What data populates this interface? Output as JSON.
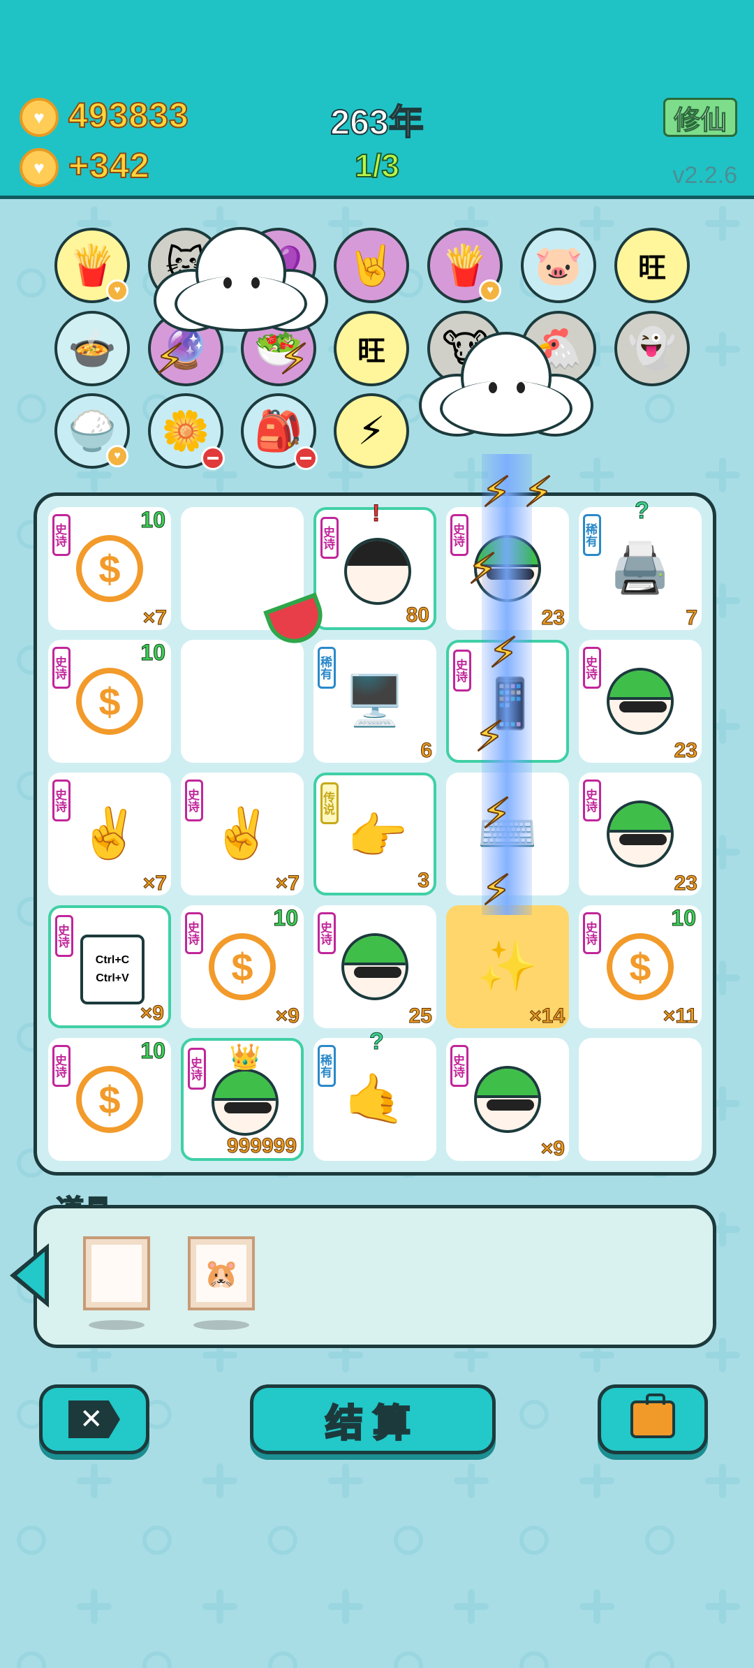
{
  "header": {
    "coins": "493833",
    "income": "+342",
    "year": "263年",
    "round": "1/3",
    "xiuxian_label": "修仙",
    "version": "v2.2.6"
  },
  "symbols": [
    {
      "icon": "🍟",
      "color": "#fff59a"
    },
    {
      "icon": "🐱",
      "color": "#d0d0c8"
    },
    {
      "icon": "💜",
      "color": "#d79ad8"
    },
    {
      "icon": "🤘",
      "color": "#d79ad8"
    },
    {
      "icon": "🍟",
      "color": "#d79ad8"
    },
    {
      "icon": "🐷",
      "color": "#c8ecf4"
    },
    {
      "icon": "旺",
      "color": "#fff59a"
    },
    {
      "icon": "🍲",
      "color": "#d0f0f4"
    },
    {
      "icon": "🔮",
      "color": "#d79ad8"
    },
    {
      "icon": "🥗",
      "color": "#d79ad8"
    },
    {
      "icon": "旺",
      "color": "#fff59a"
    },
    {
      "icon": "🐮",
      "color": "#d0d0c8"
    },
    {
      "icon": "🐔",
      "color": "#d0d0c8"
    },
    {
      "icon": "👻",
      "color": "#d0d0c8"
    },
    {
      "icon": "🍚",
      "color": "#c8ecf4"
    },
    {
      "icon": "🌼",
      "color": "#c8ecf4"
    },
    {
      "icon": "🎒",
      "color": "#c8ecf4"
    },
    {
      "icon": "⚡",
      "color": "#fff59a"
    }
  ],
  "tags": {
    "epic": "史诗",
    "rare": "稀有",
    "legend": "传说"
  },
  "cells": [
    {
      "tag": "epic",
      "icon": "coin",
      "top": "10",
      "value": "×7"
    },
    {
      "tag": "",
      "icon": "",
      "top": "",
      "value": ""
    },
    {
      "tag": "epic",
      "icon": "hairface",
      "top": "",
      "value": "80",
      "mark": "!"
    },
    {
      "tag": "epic",
      "icon": "face",
      "top": "",
      "value": "23"
    },
    {
      "tag": "rare",
      "icon": "printer",
      "top": "",
      "value": "7",
      "mark": "?"
    },
    {
      "tag": "epic",
      "icon": "coin",
      "top": "10",
      "value": ""
    },
    {
      "tag": "",
      "icon": "",
      "top": "",
      "value": ""
    },
    {
      "tag": "rare",
      "icon": "server",
      "top": "",
      "value": "6"
    },
    {
      "tag": "epic",
      "icon": "phone",
      "top": "",
      "value": ""
    },
    {
      "tag": "epic",
      "icon": "face",
      "top": "",
      "value": "23"
    },
    {
      "tag": "epic",
      "icon": "hand",
      "top": "",
      "value": "×7"
    },
    {
      "tag": "epic",
      "icon": "hand",
      "top": "",
      "value": "×7"
    },
    {
      "tag": "legend",
      "icon": "hand-yellow",
      "top": "",
      "value": "3"
    },
    {
      "tag": "",
      "icon": "keyboard",
      "top": "",
      "value": ""
    },
    {
      "tag": "epic",
      "icon": "face",
      "top": "",
      "value": "23"
    },
    {
      "tag": "epic",
      "icon": "ctrl",
      "top": "",
      "value": "×9",
      "ctrl1": "Ctrl+C",
      "ctrl2": "Ctrl+V"
    },
    {
      "tag": "epic",
      "icon": "coin",
      "top": "10",
      "value": "×9"
    },
    {
      "tag": "epic",
      "icon": "face",
      "top": "",
      "value": "25"
    },
    {
      "tag": "",
      "icon": "stars",
      "top": "",
      "value": "×14"
    },
    {
      "tag": "epic",
      "icon": "coin",
      "top": "10",
      "value": "×11"
    },
    {
      "tag": "epic",
      "icon": "coin",
      "top": "10",
      "value": ""
    },
    {
      "tag": "epic",
      "icon": "kingface",
      "top": "",
      "value": "999999"
    },
    {
      "tag": "rare",
      "icon": "hand-brown",
      "top": "",
      "value": "",
      "mark": "?"
    },
    {
      "tag": "epic",
      "icon": "face",
      "top": "",
      "value": "×9"
    },
    {
      "tag": "",
      "icon": "",
      "top": "",
      "value": ""
    }
  ],
  "tools": {
    "title": "道具",
    "items": [
      {
        "icon": ""
      },
      {
        "icon": "🐹"
      }
    ]
  },
  "buttons": {
    "settle_label": "结算"
  },
  "colors": {
    "header": "#1fc3c6",
    "background": "#a9dde6",
    "accent": "#23c8c9"
  }
}
